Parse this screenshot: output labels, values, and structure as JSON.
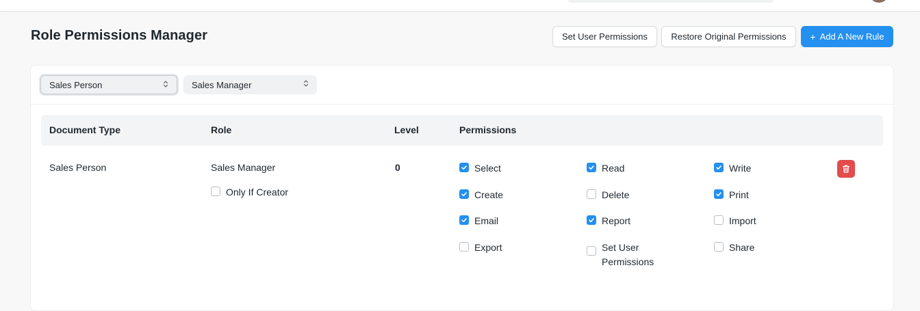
{
  "header": {
    "title": "Role Permissions Manager",
    "set_user_permissions_label": "Set User Permissions",
    "restore_label": "Restore Original Permissions",
    "add_rule_plus": "+",
    "add_rule_label": "Add A New Rule"
  },
  "filters": {
    "document_type": "Sales Person",
    "role": "Sales Manager"
  },
  "table": {
    "headers": {
      "document_type": "Document Type",
      "role": "Role",
      "level": "Level",
      "permissions": "Permissions"
    },
    "row": {
      "document_type": "Sales Person",
      "role": "Sales Manager",
      "only_if_creator_label": "Only If Creator",
      "only_if_creator_checked": false,
      "level": "0",
      "permissions": [
        {
          "label": "Select",
          "checked": true
        },
        {
          "label": "Read",
          "checked": true
        },
        {
          "label": "Write",
          "checked": true
        },
        {
          "label": "Create",
          "checked": true
        },
        {
          "label": "Delete",
          "checked": false
        },
        {
          "label": "Print",
          "checked": true
        },
        {
          "label": "Email",
          "checked": true
        },
        {
          "label": "Report",
          "checked": true
        },
        {
          "label": "Import",
          "checked": false
        },
        {
          "label": "Export",
          "checked": false
        },
        {
          "label": "Set User Permissions",
          "checked": false
        },
        {
          "label": "Share",
          "checked": false
        }
      ]
    }
  },
  "colors": {
    "primary": "#2490ef",
    "danger": "#e24c4c"
  }
}
